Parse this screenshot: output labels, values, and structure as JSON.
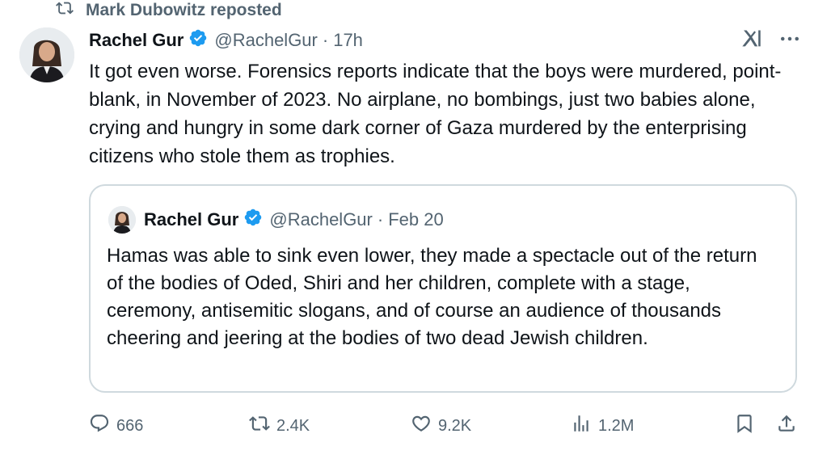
{
  "repost": {
    "text": "Mark Dubowitz reposted",
    "icon": "repost-icon"
  },
  "tweet": {
    "author_name": "Rachel Gur",
    "handle": "@RachelGur",
    "separator": "·",
    "time": "17h",
    "text": "It got even worse. Forensics reports indicate that the boys were murdered, point-blank, in November of 2023. No airplane, no bombings, just two babies alone, crying and hungry in some dark corner of Gaza murdered by the enterprising citizens who stole them as trophies."
  },
  "quote": {
    "author_name": "Rachel Gur",
    "handle": "@RachelGur",
    "separator": "·",
    "time": "Feb 20",
    "text": "Hamas was able to sink even lower, they made a spectacle out of the return of the bodies of Oded, Shiri and her children, complete with a stage, ceremony, antisemitic slogans, and of course an audience of thousands cheering and jeering at the bodies of two dead Jewish children."
  },
  "actions": {
    "replies": "666",
    "reposts": "2.4K",
    "likes": "9.2K",
    "views": "1.2M"
  },
  "colors": {
    "verified": "#1d9bf0",
    "secondary_text": "#536471",
    "border": "#cfd9de"
  }
}
